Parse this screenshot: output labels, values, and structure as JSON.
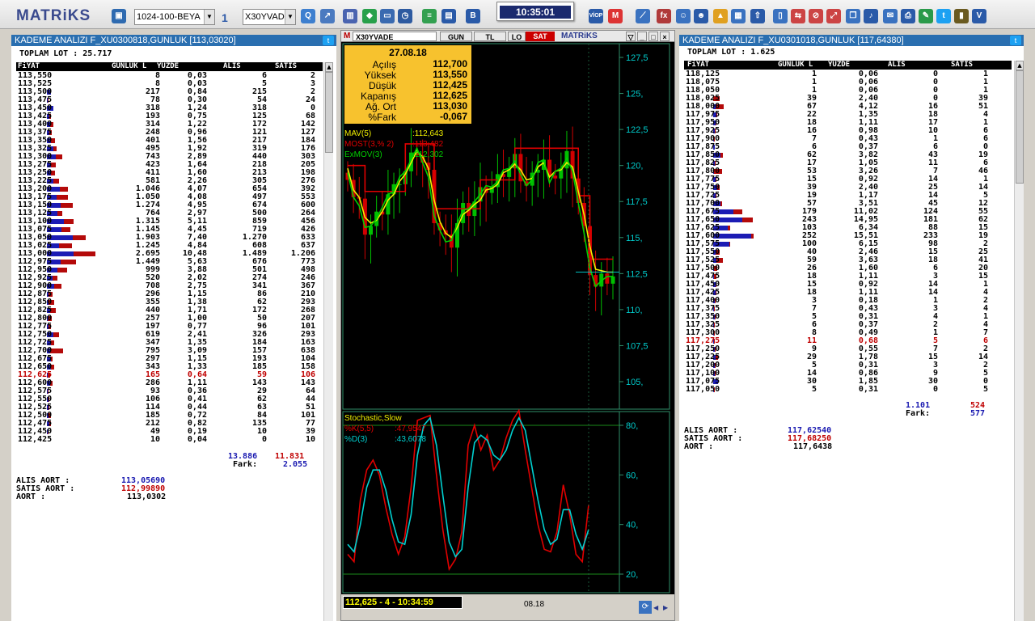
{
  "app": {
    "logo": "MATRiKS",
    "clock": "10:35:01"
  },
  "toolbar": {
    "page_combo": "1024-100-BEYA",
    "layout_combo": "1",
    "symbol_combo": "X30YVAD"
  },
  "left": {
    "title": "KADEME ANALIZI F_XU0300818,GUNLUK [113,03020]",
    "toplam_lot": "TOPLAM LOT : 25.717",
    "columns": [
      "FiYAT",
      "GUNLUK L",
      "YUZDE",
      "ALIS",
      "SATIS"
    ],
    "rows": [
      [
        "113,550",
        "8",
        "0,03",
        "6",
        "2",
        0
      ],
      [
        "113,525",
        "8",
        "0,03",
        "5",
        "3",
        0
      ],
      [
        "113,500",
        "217",
        "0,84",
        "215",
        "2",
        0
      ],
      [
        "113,475",
        "78",
        "0,30",
        "54",
        "24",
        0
      ],
      [
        "113,450",
        "318",
        "1,24",
        "318",
        "0",
        0
      ],
      [
        "113,425",
        "193",
        "0,75",
        "125",
        "68",
        0
      ],
      [
        "113,400",
        "314",
        "1,22",
        "172",
        "142",
        0
      ],
      [
        "113,375",
        "248",
        "0,96",
        "121",
        "127",
        0
      ],
      [
        "113,350",
        "401",
        "1,56",
        "217",
        "184",
        0
      ],
      [
        "113,325",
        "495",
        "1,92",
        "319",
        "176",
        0
      ],
      [
        "113,300",
        "743",
        "2,89",
        "440",
        "303",
        0
      ],
      [
        "113,275",
        "423",
        "1,64",
        "218",
        "205",
        0
      ],
      [
        "113,250",
        "411",
        "1,60",
        "213",
        "198",
        0
      ],
      [
        "113,225",
        "581",
        "2,26",
        "305",
        "276",
        0
      ],
      [
        "113,200",
        "1.046",
        "4,07",
        "654",
        "392",
        0
      ],
      [
        "113,175",
        "1.050",
        "4,08",
        "497",
        "553",
        0
      ],
      [
        "113,150",
        "1.274",
        "4,95",
        "674",
        "600",
        0
      ],
      [
        "113,125",
        "764",
        "2,97",
        "500",
        "264",
        0
      ],
      [
        "113,100",
        "1.315",
        "5,11",
        "859",
        "456",
        0
      ],
      [
        "113,075",
        "1.145",
        "4,45",
        "719",
        "426",
        0
      ],
      [
        "113,050",
        "1.903",
        "7,40",
        "1.270",
        "633",
        0
      ],
      [
        "113,025",
        "1.245",
        "4,84",
        "608",
        "637",
        0
      ],
      [
        "113,000",
        "2.695",
        "10,48",
        "1.489",
        "1.206",
        0
      ],
      [
        "112,975",
        "1.449",
        "5,63",
        "676",
        "773",
        0
      ],
      [
        "112,950",
        "999",
        "3,88",
        "501",
        "498",
        0
      ],
      [
        "112,925",
        "520",
        "2,02",
        "274",
        "246",
        0
      ],
      [
        "112,900",
        "708",
        "2,75",
        "341",
        "367",
        0
      ],
      [
        "112,875",
        "296",
        "1,15",
        "86",
        "210",
        0
      ],
      [
        "112,850",
        "355",
        "1,38",
        "62",
        "293",
        0
      ],
      [
        "112,825",
        "440",
        "1,71",
        "172",
        "268",
        0
      ],
      [
        "112,800",
        "257",
        "1,00",
        "50",
        "207",
        0
      ],
      [
        "112,775",
        "197",
        "0,77",
        "96",
        "101",
        0
      ],
      [
        "112,750",
        "619",
        "2,41",
        "326",
        "293",
        0
      ],
      [
        "112,725",
        "347",
        "1,35",
        "184",
        "163",
        0
      ],
      [
        "112,700",
        "795",
        "3,09",
        "157",
        "638",
        0
      ],
      [
        "112,675",
        "297",
        "1,15",
        "193",
        "104",
        0
      ],
      [
        "112,650",
        "343",
        "1,33",
        "185",
        "158",
        0
      ],
      [
        "112,625",
        "165",
        "0,64",
        "59",
        "106",
        1
      ],
      [
        "112,600",
        "286",
        "1,11",
        "143",
        "143",
        0
      ],
      [
        "112,575",
        "93",
        "0,36",
        "29",
        "64",
        0
      ],
      [
        "112,550",
        "106",
        "0,41",
        "62",
        "44",
        0
      ],
      [
        "112,525",
        "114",
        "0,44",
        "63",
        "51",
        0
      ],
      [
        "112,500",
        "185",
        "0,72",
        "84",
        "101",
        0
      ],
      [
        "112,475",
        "212",
        "0,82",
        "135",
        "77",
        0
      ],
      [
        "112,450",
        "49",
        "0,19",
        "10",
        "39",
        0
      ],
      [
        "112,425",
        "10",
        "0,04",
        "0",
        "10",
        0
      ]
    ],
    "tot_alis": "13.886",
    "tot_satis": "11.831",
    "fark_label": "Fark:",
    "fark": "2.055",
    "alis_aort_label": "ALIS AORT :",
    "alis_aort": "113,05690",
    "satis_aort_label": "SATIS AORT :",
    "satis_aort": "112,99890",
    "aort_label": "AORT :",
    "aort": "113,0302"
  },
  "right": {
    "title": "KADEME ANALIZI F_XU0301018,GUNLUK [117,64380]",
    "toplam_lot": "TOPLAM LOT : 1.625",
    "columns": [
      "FiYAT",
      "GUNLUK L",
      "YUZDE",
      "ALIS",
      "SATIS"
    ],
    "rows": [
      [
        "118,125",
        "1",
        "0,06",
        "0",
        "1",
        0
      ],
      [
        "118,075",
        "1",
        "0,06",
        "0",
        "1",
        0
      ],
      [
        "118,050",
        "1",
        "0,06",
        "0",
        "1",
        0
      ],
      [
        "118,025",
        "39",
        "2,40",
        "0",
        "39",
        0
      ],
      [
        "118,000",
        "67",
        "4,12",
        "16",
        "51",
        0
      ],
      [
        "117,975",
        "22",
        "1,35",
        "18",
        "4",
        0
      ],
      [
        "117,950",
        "18",
        "1,11",
        "17",
        "1",
        0
      ],
      [
        "117,925",
        "16",
        "0,98",
        "10",
        "6",
        0
      ],
      [
        "117,900",
        "7",
        "0,43",
        "1",
        "6",
        0
      ],
      [
        "117,875",
        "6",
        "0,37",
        "6",
        "0",
        0
      ],
      [
        "117,850",
        "62",
        "3,82",
        "43",
        "19",
        0
      ],
      [
        "117,825",
        "17",
        "1,05",
        "11",
        "6",
        0
      ],
      [
        "117,800",
        "53",
        "3,26",
        "7",
        "46",
        0
      ],
      [
        "117,775",
        "15",
        "0,92",
        "14",
        "1",
        0
      ],
      [
        "117,750",
        "39",
        "2,40",
        "25",
        "14",
        0
      ],
      [
        "117,725",
        "19",
        "1,17",
        "14",
        "5",
        0
      ],
      [
        "117,700",
        "57",
        "3,51",
        "45",
        "12",
        0
      ],
      [
        "117,675",
        "179",
        "11,02",
        "124",
        "55",
        0
      ],
      [
        "117,650",
        "243",
        "14,95",
        "181",
        "62",
        0
      ],
      [
        "117,625",
        "103",
        "6,34",
        "88",
        "15",
        0
      ],
      [
        "117,600",
        "252",
        "15,51",
        "233",
        "19",
        0
      ],
      [
        "117,575",
        "100",
        "6,15",
        "98",
        "2",
        0
      ],
      [
        "117,550",
        "40",
        "2,46",
        "15",
        "25",
        0
      ],
      [
        "117,525",
        "59",
        "3,63",
        "18",
        "41",
        0
      ],
      [
        "117,500",
        "26",
        "1,60",
        "6",
        "20",
        0
      ],
      [
        "117,475",
        "18",
        "1,11",
        "3",
        "15",
        0
      ],
      [
        "117,450",
        "15",
        "0,92",
        "14",
        "1",
        0
      ],
      [
        "117,425",
        "18",
        "1,11",
        "14",
        "4",
        0
      ],
      [
        "117,400",
        "3",
        "0,18",
        "1",
        "2",
        0
      ],
      [
        "117,375",
        "7",
        "0,43",
        "3",
        "4",
        0
      ],
      [
        "117,350",
        "5",
        "0,31",
        "4",
        "1",
        0
      ],
      [
        "117,325",
        "6",
        "0,37",
        "2",
        "4",
        0
      ],
      [
        "117,300",
        "8",
        "0,49",
        "1",
        "7",
        0
      ],
      [
        "117,275",
        "11",
        "0,68",
        "5",
        "6",
        1
      ],
      [
        "117,250",
        "9",
        "0,55",
        "7",
        "2",
        0
      ],
      [
        "117,225",
        "29",
        "1,78",
        "15",
        "14",
        0
      ],
      [
        "117,200",
        "5",
        "0,31",
        "3",
        "2",
        0
      ],
      [
        "117,100",
        "14",
        "0,86",
        "9",
        "5",
        0
      ],
      [
        "117,075",
        "30",
        "1,85",
        "30",
        "0",
        0
      ],
      [
        "117,050",
        "5",
        "0,31",
        "0",
        "5",
        0
      ]
    ],
    "tot_alis": "1.101",
    "tot_satis": "524",
    "fark_label": "Fark:",
    "fark": "577",
    "alis_aort_label": "ALIS AORT :",
    "alis_aort": "117,62540",
    "satis_aort_label": "SATIS AORT :",
    "satis_aort": "117,68250",
    "aort_label": "AORT :",
    "aort": "117,6438"
  },
  "chart": {
    "symbol": "X30YVADE",
    "tabs": [
      "GUN",
      "TL",
      "LO",
      "SAT"
    ],
    "brand": "MATRiKS",
    "info": {
      "date": "27.08.18",
      "rows": [
        [
          "Açılış",
          "112,700"
        ],
        [
          "Yüksek",
          "113,550"
        ],
        [
          "Düşük",
          "112,425"
        ],
        [
          "Kapanış",
          "112,625"
        ],
        [
          "Ağ. Ort",
          "113,030"
        ],
        [
          "%Fark",
          "-0,067"
        ]
      ]
    },
    "legend": [
      {
        "label": "MAV(5)",
        "value": ":112,643",
        "color": "#f0f000"
      },
      {
        "label": "MOST(3,% 2)",
        "value": ":113,482",
        "color": "#e00000"
      },
      {
        "label": "ExMOV(3)",
        "value": ":112,302",
        "color": "#00d000"
      }
    ],
    "price_ticks": [
      "127,5",
      "125,",
      "122,5",
      "120,",
      "117,5",
      "115,",
      "112,5",
      "110,",
      "107,5",
      "105,"
    ],
    "stoch": {
      "title": "Stochastic,Slow",
      "k_label": "%K(5,5)",
      "k_value": ":47,9547",
      "d_label": "%D(3)",
      "d_value": ":43,6078",
      "ticks": [
        "80,",
        "60,",
        "40,",
        "20,"
      ]
    },
    "bid_status": "112,625 - 4 - 10:34:59",
    "date_label": "08.18"
  },
  "chart_data": {
    "type": "line",
    "series": [
      {
        "name": "MAV(5)",
        "values": [
          119.8,
          118.3,
          117.8,
          116.4,
          116.0,
          116.2,
          116.8,
          117.6,
          118.0,
          118.9,
          119.4,
          120.2,
          121.0,
          120.6,
          119.8,
          117.6,
          116.1,
          115.3,
          115.0,
          115.7,
          116.6,
          116.9,
          117.3,
          117.6,
          118.3,
          118.4,
          118.7,
          119.5,
          119.7,
          120.1,
          119.7,
          119.0,
          119.1,
          119.9,
          120.2,
          119.2,
          119.6,
          119.7,
          120.2,
          119.9,
          118.2,
          116.6,
          114.4,
          112.8,
          112.7,
          112.6,
          112.6
        ]
      },
      {
        "name": "MOST(3,% 2)",
        "values": [
          120.0,
          120.0,
          120.0,
          118.2,
          118.2,
          118.2,
          118.2,
          118.2,
          118.2,
          118.2,
          121.5,
          121.5,
          121.5,
          121.5,
          121.5,
          117.0,
          117.0,
          117.0,
          117.0,
          117.0,
          117.0,
          117.0,
          117.0,
          119.0,
          119.0,
          119.0,
          119.0,
          119.0,
          119.0,
          121.2,
          121.2,
          121.2,
          121.2,
          121.2,
          121.2,
          121.2,
          121.2,
          121.2,
          121.2,
          121.2,
          117.9,
          117.9,
          113.5,
          113.5,
          113.5,
          113.5,
          113.5
        ]
      },
      {
        "name": "ExMOV(3)",
        "values": [
          119.5,
          117.8,
          117.2,
          115.7,
          115.8,
          116.3,
          117.1,
          118.0,
          118.2,
          119.2,
          119.6,
          120.4,
          121.2,
          120.2,
          119.2,
          116.5,
          115.5,
          114.7,
          114.8,
          116.0,
          116.9,
          117.0,
          117.5,
          118.0,
          118.6,
          118.5,
          118.9,
          119.7,
          119.8,
          120.3,
          119.4,
          118.6,
          119.0,
          120.2,
          120.4,
          118.8,
          119.6,
          119.8,
          120.5,
          119.6,
          117.4,
          115.3,
          112.9,
          111.6,
          112.0,
          112.3,
          112.3
        ]
      },
      {
        "name": "%K(5,5)",
        "values": [
          28,
          25,
          50,
          62,
          66,
          60,
          47,
          36,
          28,
          35,
          55,
          82,
          83,
          84,
          60,
          38,
          22,
          26,
          37,
          72,
          80,
          70,
          76,
          62,
          66,
          75,
          82,
          86,
          70,
          55,
          40,
          30,
          29,
          37,
          56,
          44,
          28,
          25,
          48
        ]
      },
      {
        "name": "%D(3)",
        "values": [
          32,
          29,
          40,
          55,
          62,
          62,
          54,
          42,
          33,
          32,
          44,
          68,
          80,
          83,
          72,
          52,
          33,
          27,
          30,
          55,
          73,
          76,
          74,
          68,
          66,
          70,
          78,
          83,
          78,
          64,
          50,
          38,
          32,
          34,
          46,
          46,
          36,
          30,
          38
        ]
      }
    ]
  }
}
